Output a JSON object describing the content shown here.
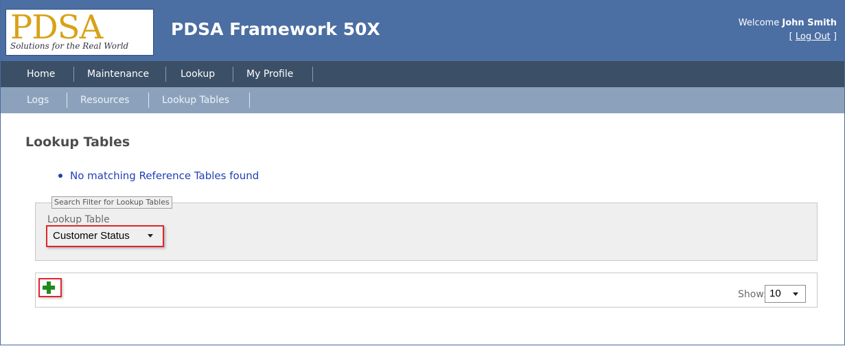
{
  "header": {
    "logo_text": "PDSA",
    "logo_tagline": "Solutions for the Real World",
    "app_title": "PDSA Framework 50X",
    "welcome_prefix": "Welcome",
    "user_name": "John Smith",
    "logout_open": "[",
    "logout_label": "Log Out",
    "logout_close": "]"
  },
  "nav": {
    "items": [
      {
        "label": "Home"
      },
      {
        "label": "Maintenance"
      },
      {
        "label": "Lookup"
      },
      {
        "label": "My Profile"
      }
    ]
  },
  "subnav": {
    "items": [
      {
        "label": "Logs"
      },
      {
        "label": "Resources"
      },
      {
        "label": "Lookup Tables"
      }
    ]
  },
  "main": {
    "page_title": "Lookup Tables",
    "messages": [
      "No matching Reference Tables found"
    ],
    "search": {
      "legend": "Search Filter for Lookup Tables",
      "field_label": "Lookup Table",
      "selected_value": "Customer Status"
    },
    "toolbar": {
      "add_icon": "plus-icon",
      "show_label": "Show:",
      "show_value": "10"
    }
  },
  "colors": {
    "header_bg": "#4b6ea3",
    "nav_bg": "#3b4f66",
    "subnav_bg": "#8ca2bc",
    "logo_gold": "#d8a217",
    "link_blue": "#1f3fb5",
    "highlight_red": "#e0242b",
    "add_green": "#1f8a1f"
  }
}
